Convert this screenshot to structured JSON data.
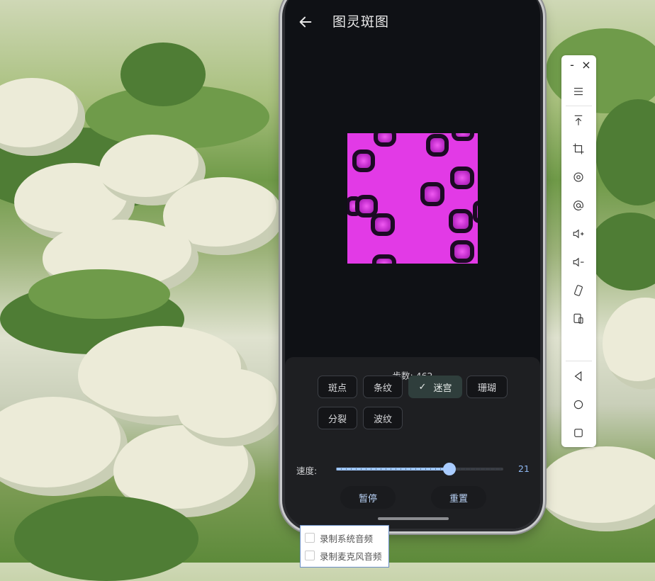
{
  "app": {
    "title": "图灵斑图"
  },
  "controls": {
    "steps_text": "步数: 462",
    "patterns": [
      {
        "label": "斑点",
        "selected": false
      },
      {
        "label": "条纹",
        "selected": false
      },
      {
        "label": "迷宫",
        "selected": true
      },
      {
        "label": "珊瑚",
        "selected": false
      },
      {
        "label": "分裂",
        "selected": false
      },
      {
        "label": "波纹",
        "selected": false
      }
    ],
    "speed_label": "速度:",
    "speed_value": "21",
    "speed_fraction": 0.68,
    "pause_label": "暂停",
    "reset_label": "重置"
  },
  "toolbar": {
    "minimize": "-",
    "close": "×",
    "icons": [
      "menu-icon",
      "upload-icon",
      "crop-icon",
      "rotate-icon",
      "at-icon",
      "volume-up-icon",
      "volume-down-icon",
      "rotate-screen-icon",
      "devices-icon",
      "back-nav-icon",
      "home-nav-icon",
      "recents-nav-icon"
    ]
  },
  "audio_options": [
    {
      "label": "录制系统音频",
      "checked": false
    },
    {
      "label": "录制麦克风音频",
      "checked": false
    }
  ],
  "colors": {
    "pattern_bg": "#e23ae6",
    "spot_ring": "#1c0a24",
    "spot_center": "#c630d1",
    "accent": "#9ec6ff"
  }
}
